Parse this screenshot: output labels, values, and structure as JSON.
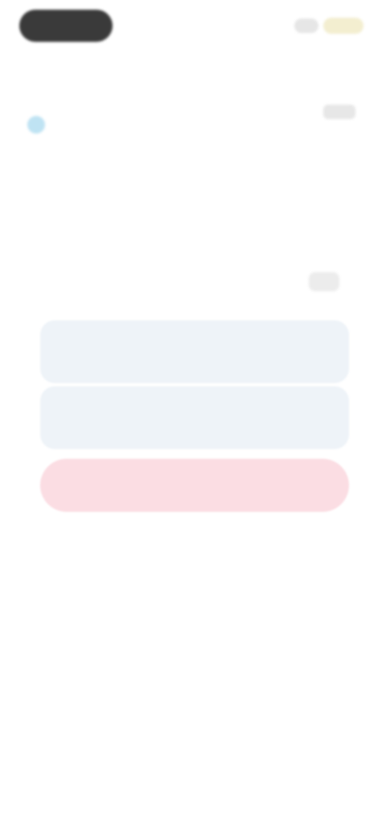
{
  "status": {},
  "header": {
    "title": ""
  },
  "card": {
    "description": ""
  },
  "tabs": [
    {
      "label": ""
    },
    {
      "label": ""
    },
    {
      "label": ""
    }
  ],
  "actions": {
    "option_1": "",
    "option_2": "",
    "danger": ""
  },
  "colors": {
    "status_pill": "#3a3a3a",
    "info_icon": "#bfe3f3",
    "option_bg": "#eef3f8",
    "danger_bg": "#fbdde3"
  }
}
